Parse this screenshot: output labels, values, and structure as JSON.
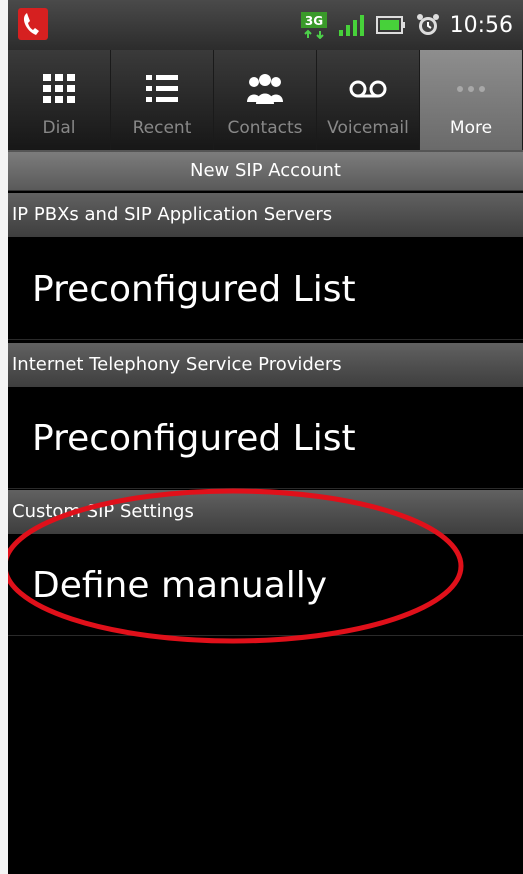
{
  "status_bar": {
    "network": "3G",
    "time": "10:56",
    "icons": [
      "phone-app-icon",
      "3g-icon",
      "signal-bars-icon",
      "battery-icon",
      "alarm-icon"
    ]
  },
  "tabs": [
    {
      "label": "Dial",
      "icon": "dialpad-icon",
      "active": false
    },
    {
      "label": "Recent",
      "icon": "list-icon",
      "active": false
    },
    {
      "label": "Contacts",
      "icon": "contacts-icon",
      "active": false
    },
    {
      "label": "Voicemail",
      "icon": "voicemail-icon",
      "active": false
    },
    {
      "label": "More",
      "icon": "more-icon",
      "active": true
    }
  ],
  "page_title": "New SIP Account",
  "sections": [
    {
      "header": "IP PBXs and SIP Application Servers",
      "item": "Preconfigured List"
    },
    {
      "header": "Internet Telephony Service Providers",
      "item": "Preconfigured List"
    },
    {
      "header": "Custom SIP Settings",
      "item": "Define manually"
    }
  ],
  "colors": {
    "annotation_circle": "#e0101a",
    "active_tab": "#7a7a7a",
    "background": "#000000"
  }
}
